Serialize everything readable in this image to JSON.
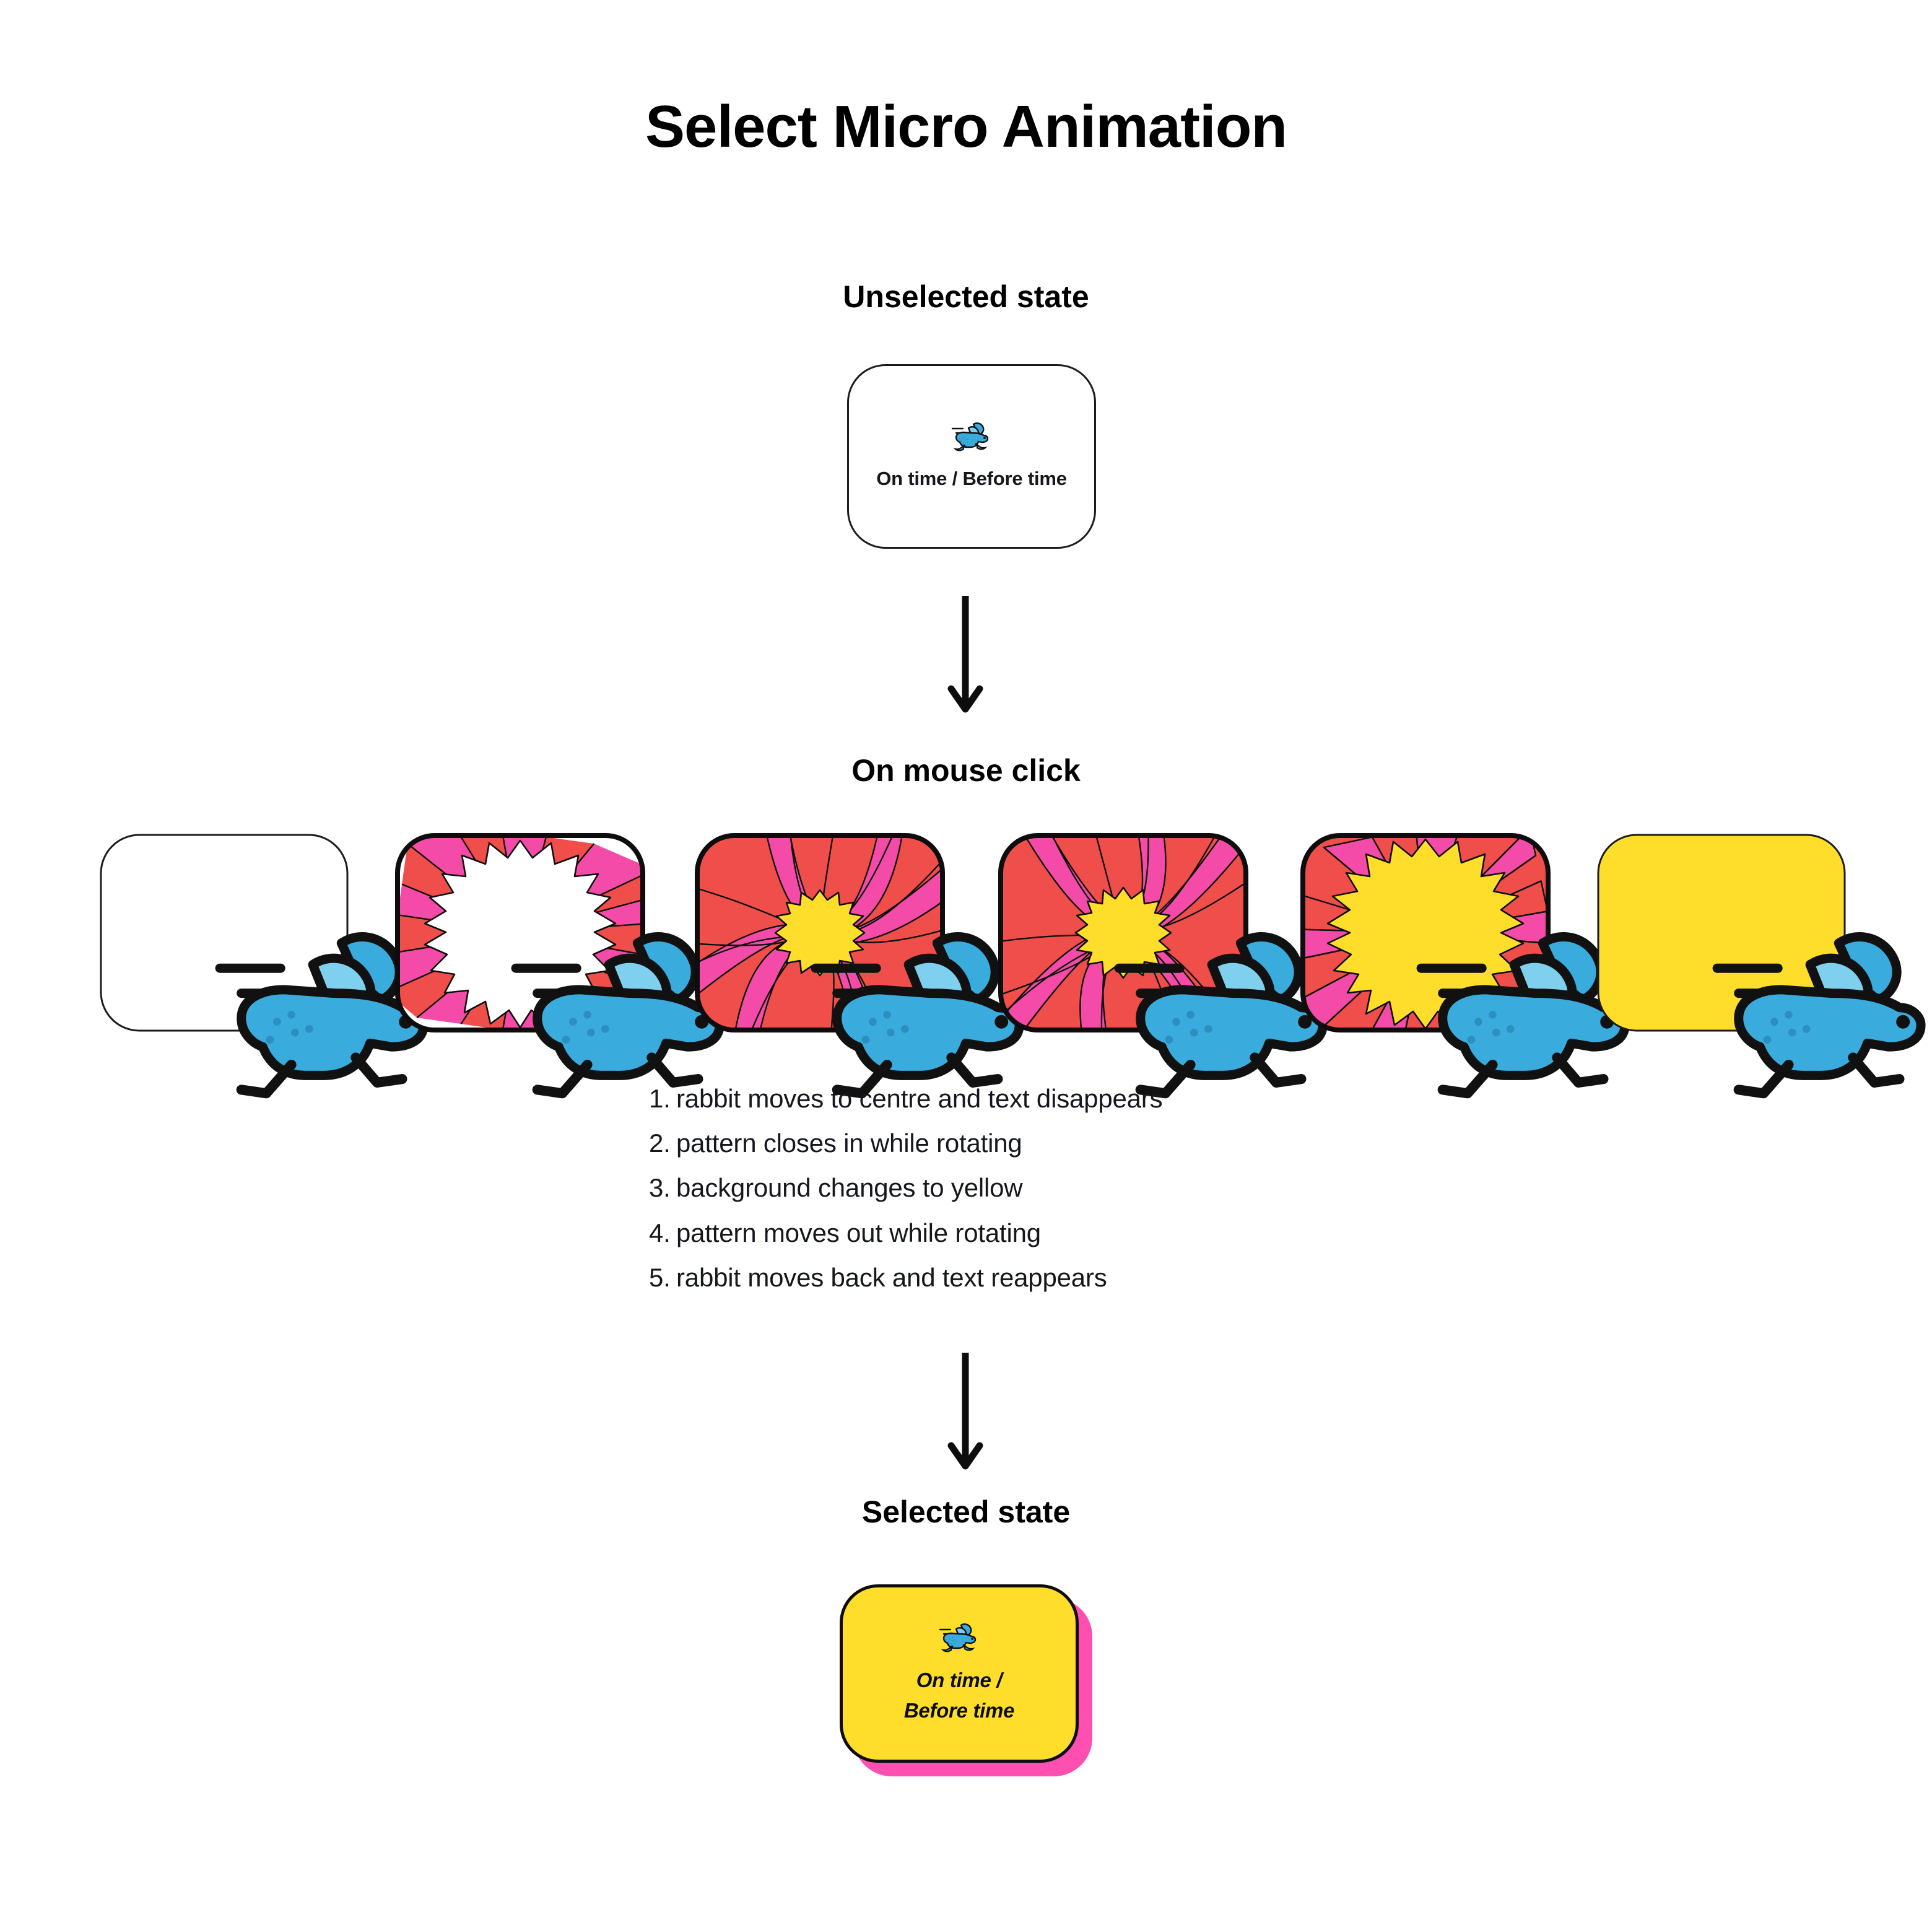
{
  "title": "Select Micro Animation",
  "sections": {
    "unselected_heading": "Unselected state",
    "onclick_heading": "On mouse click",
    "selected_heading": "Selected state"
  },
  "cards": {
    "unselected": {
      "icon": "running-rabbit-icon",
      "label": "On time / Before time",
      "background": "#ffffff",
      "border": "#1c1c1c"
    },
    "selected": {
      "icon": "running-rabbit-icon",
      "label_line_1": "On time /",
      "label_line_2": "Before time",
      "background": "#ffde2b",
      "shadow": "#ff4fb0",
      "border": "#0d0d0d"
    }
  },
  "palette": {
    "red": "#f04e4a",
    "pink": "#f54ba8",
    "yellow": "#ffde2b",
    "white": "#ffffff",
    "outline": "#0d0d0d",
    "rabbit_blue": "#3aabdd",
    "rabbit_blue_dark": "#2b8fc0"
  },
  "frames": [
    {
      "name": "frame-1-white-rabbit-centred",
      "fill": "#ffffff",
      "pattern": "none",
      "burst": "none"
    },
    {
      "name": "frame-2-pattern-closing-in",
      "fill": "#ffffff",
      "pattern": "wedges",
      "burst": "white-star-large"
    },
    {
      "name": "frame-3-pattern-closed",
      "fill": "#f04e4a",
      "pattern": "spiral",
      "burst": "yellow-star-small"
    },
    {
      "name": "frame-4-pattern-rotating",
      "fill": "#f04e4a",
      "pattern": "spiral",
      "burst": "yellow-star-small"
    },
    {
      "name": "frame-5-pattern-moving-out",
      "fill": "#f04e4a",
      "pattern": "wedges",
      "burst": "yellow-star-large"
    },
    {
      "name": "frame-6-solid-yellow",
      "fill": "#ffde2b",
      "pattern": "none",
      "burst": "none"
    }
  ],
  "steps": [
    {
      "num": "1.",
      "text": "rabbit moves to centre and text disappears"
    },
    {
      "num": "2.",
      "text": "pattern closes in while rotating"
    },
    {
      "num": "3.",
      "text": "background changes to yellow"
    },
    {
      "num": "4.",
      "text": "pattern moves out while rotating"
    },
    {
      "num": "5.",
      "text": "rabbit moves back and text reappears"
    }
  ],
  "arrows": {
    "first": "arrow-down-icon",
    "second": "arrow-down-icon"
  }
}
